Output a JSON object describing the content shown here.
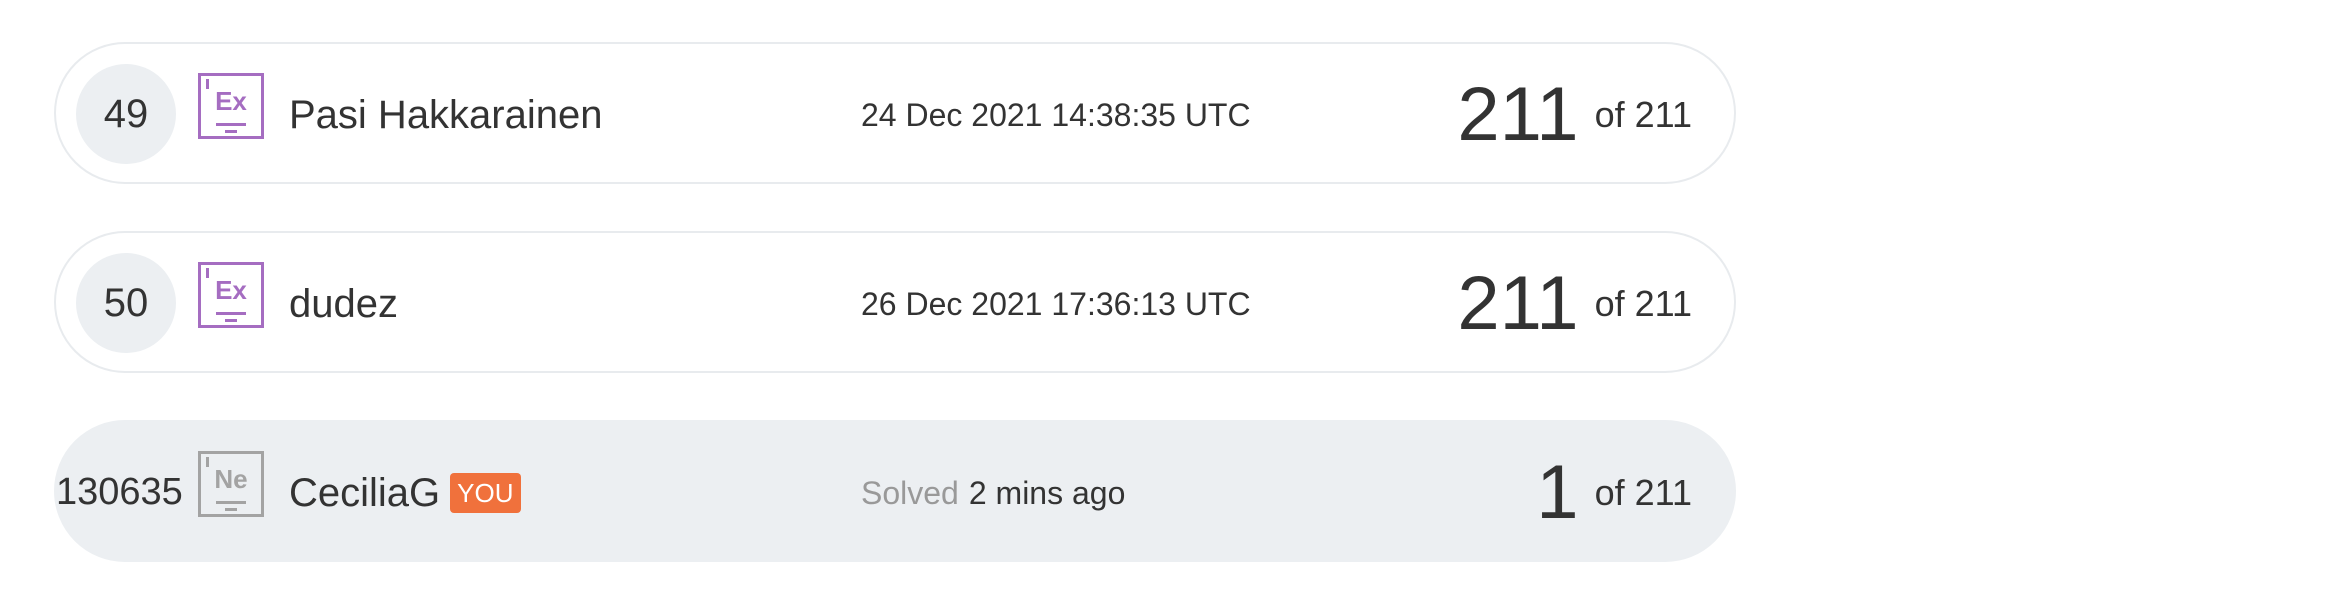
{
  "colors": {
    "element_badge_active": "#a56dc1",
    "element_badge_inactive": "#a3a3a3",
    "you_badge": "#f0713c",
    "row_border": "#e8ebee",
    "current_user_row_bg": "#eceff2"
  },
  "rows": [
    {
      "rank": "49",
      "element_symbol": "Ex",
      "name": "Pasi Hakkarainen",
      "time_prefix": "",
      "time": "24 Dec 2021 14:38:35 UTC",
      "score": "211",
      "of_total": "of 211"
    },
    {
      "rank": "50",
      "element_symbol": "Ex",
      "name": "dudez",
      "time_prefix": "",
      "time": "26 Dec 2021 17:36:13 UTC",
      "score": "211",
      "of_total": "of 211"
    },
    {
      "rank": "130635",
      "element_symbol": "Ne",
      "name": "CeciliaG",
      "you_label": "YOU",
      "time_prefix": "Solved",
      "time": "2 mins ago",
      "score": "1",
      "of_total": "of 211"
    }
  ]
}
